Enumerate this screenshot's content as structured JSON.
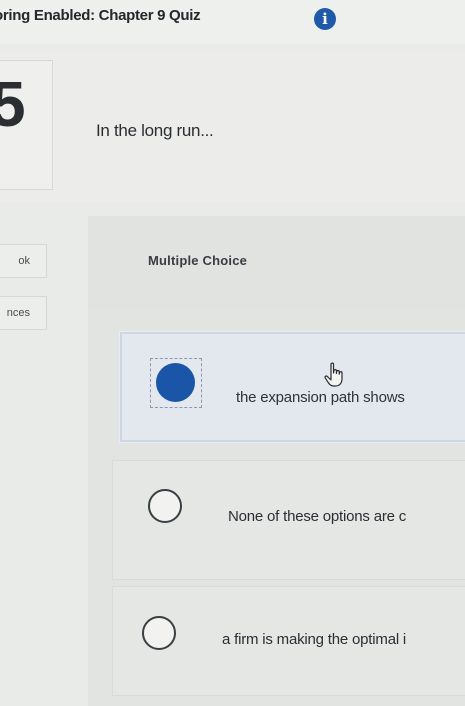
{
  "header": {
    "title": "oring Enabled: Chapter 9 Quiz",
    "info_icon": "info-icon"
  },
  "question": {
    "number": "5",
    "text": "In the long run..."
  },
  "side_tabs": [
    {
      "label": "ok"
    },
    {
      "label": "nces"
    }
  ],
  "question_type": "Multiple Choice",
  "options": [
    {
      "text": "the expansion path shows",
      "selected": true
    },
    {
      "text": "None of these options are c",
      "selected": false
    },
    {
      "text": "a firm is making the optimal i",
      "selected": false
    }
  ],
  "colors": {
    "accent": "#1a55a8",
    "background": "#e9ebe8"
  },
  "cursor": "hand-pointer-icon"
}
